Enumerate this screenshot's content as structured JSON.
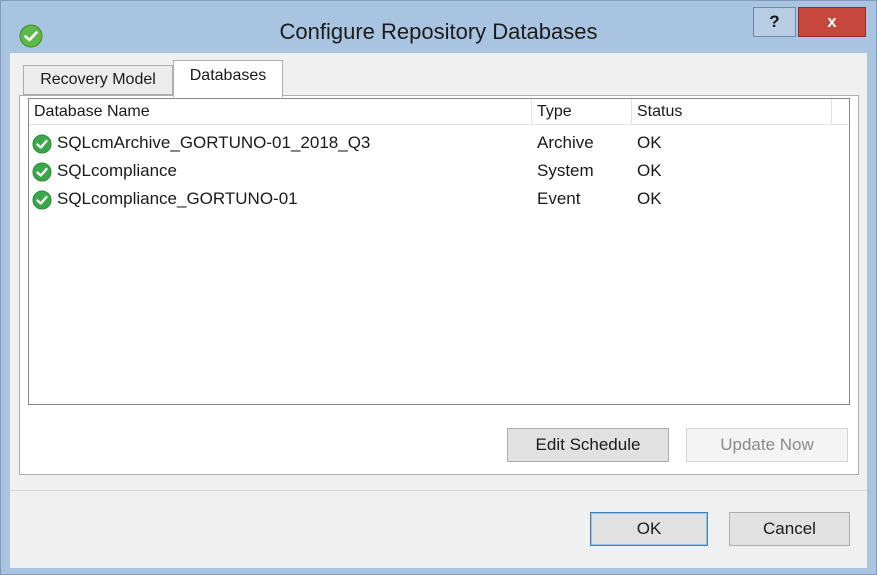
{
  "window": {
    "title": "Configure Repository Databases",
    "help_label": "?",
    "close_label": "x"
  },
  "tabs": [
    {
      "label": "Recovery Model",
      "active": false
    },
    {
      "label": "Databases",
      "active": true
    }
  ],
  "list": {
    "columns": [
      "Database Name",
      "Type",
      "Status"
    ],
    "rows": [
      {
        "name": "SQLcmArchive_GORTUNO-01_2018_Q3",
        "type": "Archive",
        "status": "OK",
        "icon": "check-icon"
      },
      {
        "name": "SQLcompliance",
        "type": "System",
        "status": "OK",
        "icon": "check-icon"
      },
      {
        "name": "SQLcompliance_GORTUNO-01",
        "type": "Event",
        "status": "OK",
        "icon": "check-icon"
      }
    ]
  },
  "buttons": {
    "edit_schedule": "Edit Schedule",
    "update_now": "Update Now",
    "ok": "OK",
    "cancel": "Cancel"
  },
  "colors": {
    "titlebar": "#a9c4e1",
    "close": "#c6473c",
    "status_ok": "#3aa84a"
  }
}
